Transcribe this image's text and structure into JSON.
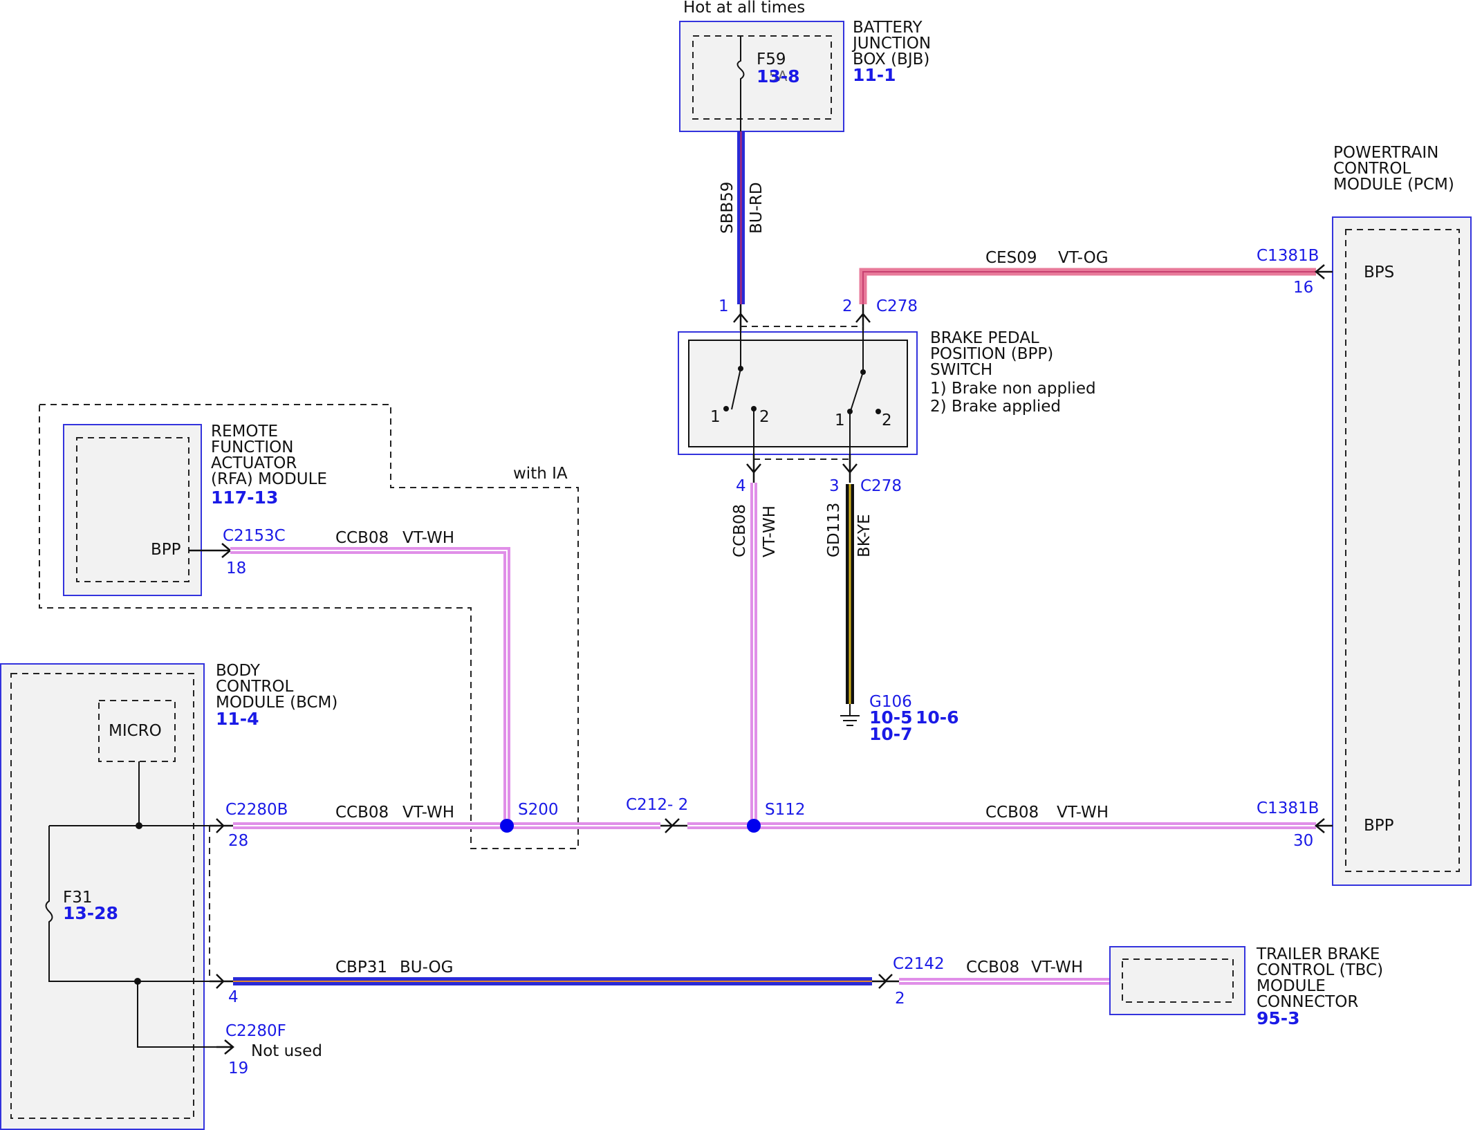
{
  "colors": {
    "module_border": "#3333dd",
    "module_fill": "#f2f2f2",
    "dash": "#222222",
    "wire_pink": "#e08fe8",
    "wire_blue": "#2a2ad6",
    "wire_black": "#111111",
    "wire_yellow": "#d4b21a",
    "splice": "#0000ee",
    "link_blue": "#1a1ae6"
  },
  "bjb": {
    "hot_label": "Hot at all times",
    "fuse": "F59",
    "fuse_ref": "13-8",
    "fuse_extra": "5A",
    "name": [
      "BATTERY",
      "JUNCTION",
      "BOX (BJB)"
    ],
    "ref": "11-1"
  },
  "pcm": {
    "name": [
      "POWERTRAIN",
      "CONTROL",
      "MODULE (PCM)"
    ],
    "bps_pin_name": "BPS",
    "bps_connector": "C1381B",
    "bps_pin": "16",
    "bpp_pin_name": "BPP",
    "bpp_connector": "C1381B",
    "bpp_pin": "30"
  },
  "bpp_switch": {
    "name": [
      "BRAKE PEDAL",
      "POSITION (BPP)",
      "SWITCH",
      "1) Brake non applied",
      "2) Brake applied"
    ],
    "connector": "C278",
    "pin1": "1",
    "pin2": "2",
    "pin3": "3",
    "pin4": "4",
    "contact_1": "1",
    "contact_2": "2"
  },
  "rfa": {
    "name": [
      "REMOTE",
      "FUNCTION",
      "ACTUATOR",
      "(RFA) MODULE"
    ],
    "ref": "117-13",
    "pin_name": "BPP",
    "connector": "C2153C",
    "pin": "18",
    "option_label": "with IA"
  },
  "bcm": {
    "name": [
      "BODY",
      "CONTROL",
      "MODULE (BCM)"
    ],
    "ref": "11-4",
    "micro": "MICRO",
    "fuse": "F31",
    "fuse_ref": "13-28",
    "connector_b": "C2280B",
    "pin_28": "28",
    "pin_4": "4",
    "connector_f": "C2280F",
    "pin_19": "19",
    "not_used": "Not used"
  },
  "tbc": {
    "name": [
      "TRAILER BRAKE",
      "CONTROL (TBC)",
      "MODULE",
      "CONNECTOR"
    ],
    "ref": "95-3",
    "connector": "C2142",
    "pin": "2"
  },
  "wires": {
    "sbb59": {
      "circuit": "SBB59",
      "color": "BU-RD"
    },
    "ces09": {
      "circuit": "CES09",
      "color": "VT-OG"
    },
    "ccb08_sw": {
      "circuit": "CCB08",
      "color": "VT-WH"
    },
    "gd113": {
      "circuit": "GD113",
      "color": "BK-YE"
    },
    "ccb08_rfa": {
      "circuit": "CCB08",
      "color": "VT-WH"
    },
    "ccb08_bcm": {
      "circuit": "CCB08",
      "color": "VT-WH"
    },
    "ccb08_pcm": {
      "circuit": "CCB08",
      "color": "VT-WH"
    },
    "cbp31": {
      "circuit": "CBP31",
      "color": "BU-OG"
    },
    "ccb08_tbc": {
      "circuit": "CCB08",
      "color": "VT-WH"
    }
  },
  "splices": {
    "s200": "S200",
    "s112": "S112",
    "c212": "C212- 2"
  },
  "ground": {
    "name": "G106",
    "refs": [
      "10-5",
      "10-6",
      "10-7"
    ]
  }
}
